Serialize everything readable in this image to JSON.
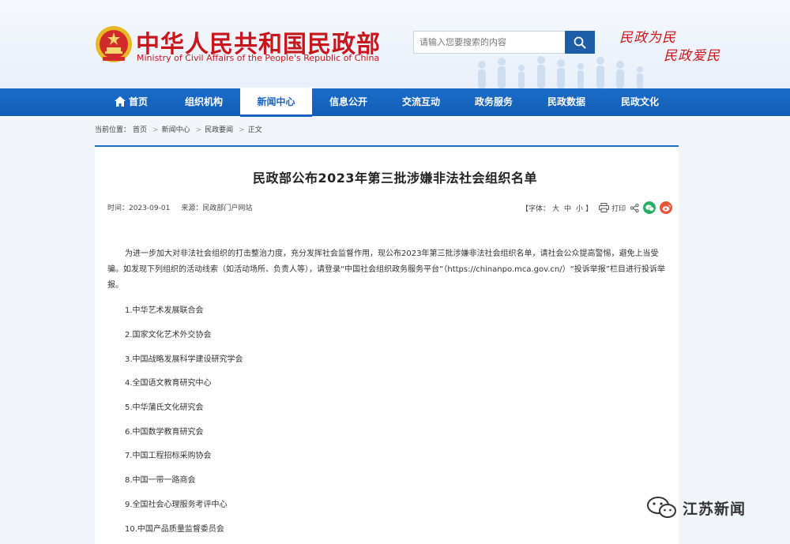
{
  "header": {
    "title_cn": "中华人民共和国民政部",
    "title_en": "Ministry of Civil Affairs of the People's Republic of China",
    "search_placeholder": "请输入您要搜索的内容",
    "slogan_line1": "民政为民",
    "slogan_line2": "民政爱民"
  },
  "nav": {
    "items": [
      {
        "label": "首页"
      },
      {
        "label": "组织机构"
      },
      {
        "label": "新闻中心"
      },
      {
        "label": "信息公开"
      },
      {
        "label": "交流互动"
      },
      {
        "label": "政务服务"
      },
      {
        "label": "民政数据"
      },
      {
        "label": "民政文化"
      }
    ],
    "active": "新闻中心"
  },
  "breadcrumb": {
    "prefix": "当前位置：",
    "items": [
      "首页",
      "新闻中心",
      "民政要闻",
      "正文"
    ]
  },
  "article": {
    "title": "民政部公布2023年第三批涉嫌非法社会组织名单",
    "time": "时间：2023-09-01",
    "source": "来源：民政部门户网站",
    "font_size_label": "【字体：",
    "font_sizes": [
      "大",
      "中",
      "小"
    ],
    "font_size_end": "】",
    "print_label": "打印",
    "paragraph": "为进一步加大对非法社会组织的打击整治力度，充分发挥社会监督作用，现公布2023年第三批涉嫌非法社会组织名单，请社会公众提高警惕，避免上当受骗。如发现下列组织的活动线索（如活动场所、负责人等），请登录“中国社会组织政务服务平台”（https://chinanpo.mca.gov.cn/）“投诉举报”栏目进行投诉举报。",
    "list": [
      "1.中华艺术发展联合会",
      "2.国家文化艺术外交协会",
      "3.中国战略发展科学建设研究学会",
      "4.全国语文教育研究中心",
      "5.中华蒲氏文化研究会",
      "6.中国数学教育研究会",
      "7.中国工程招标采购协会",
      "8.中国一带一路商会",
      "9.全国社会心理服务考评中心",
      "10.中国产品质量监督委员会"
    ]
  },
  "watermark": {
    "text": "江苏新闻"
  },
  "colors": {
    "brand_red": "#c8161d",
    "nav_blue": "#1565c0",
    "wechat_green": "#2aae67",
    "weibo_red": "#e6553a"
  }
}
